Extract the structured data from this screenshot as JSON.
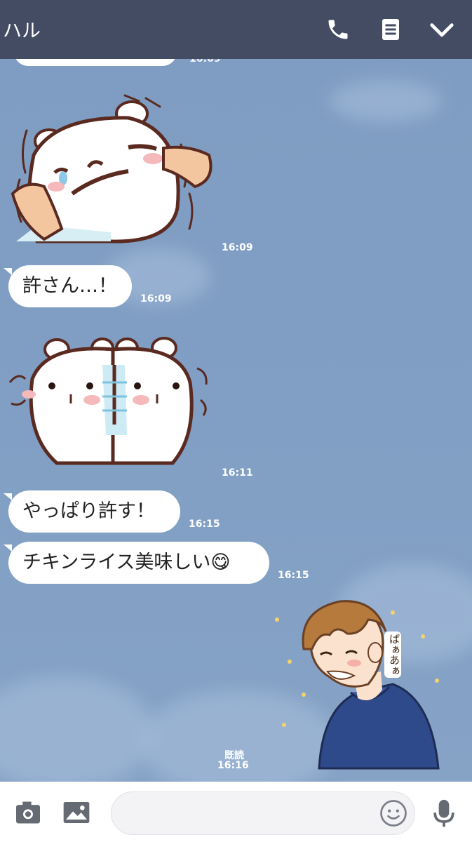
{
  "header": {
    "title": "ハル",
    "icons": [
      "phone-icon",
      "notes-icon",
      "chevron-down-icon"
    ]
  },
  "messages": [
    {
      "type": "sticker",
      "sticker": "bear-stretching-face",
      "time": "16:09"
    },
    {
      "type": "text",
      "text": "許さん…！",
      "time": "16:09"
    },
    {
      "type": "sticker",
      "sticker": "two-bears-touching-heads",
      "time": "16:11"
    },
    {
      "type": "text",
      "text": "やっぱり許す！",
      "time": "16:15"
    },
    {
      "type": "text",
      "text": "チキンライス美味しい😋",
      "time": "16:15"
    },
    {
      "type": "sticker",
      "sticker": "laughing-boy-blue-sweater",
      "sticker_text": "ぱぁあぁ",
      "read_label": "既読",
      "time": "16:16"
    }
  ],
  "partial_top_time": "16:09",
  "input_bar": {
    "placeholder": "",
    "icons": [
      "camera-icon",
      "image-icon",
      "emoji-icon",
      "microphone-icon"
    ]
  },
  "colors": {
    "header_bg": "#434c63",
    "chat_bg": "#7f9dc2",
    "bubble": "#ffffff"
  }
}
